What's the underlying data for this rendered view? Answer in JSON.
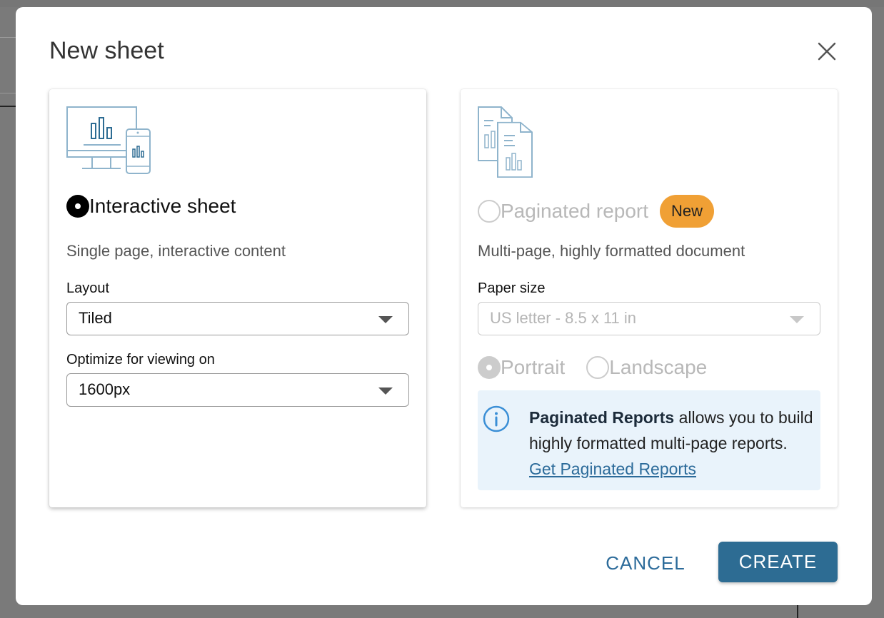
{
  "dialog": {
    "title": "New sheet"
  },
  "interactive": {
    "option_label": "Interactive sheet",
    "selected": true,
    "description": "Single page, interactive content",
    "layout_label": "Layout",
    "layout_value": "Tiled",
    "optimize_label": "Optimize for viewing on",
    "optimize_value": "1600px",
    "illustration_icon": "desktop-mobile-chart-icon"
  },
  "paginated": {
    "option_label": "Paginated report",
    "selected": false,
    "badge": "New",
    "description": "Multi-page, highly formatted document",
    "paper_label": "Paper size",
    "paper_value": "US letter - 8.5 x 11 in",
    "portrait_label": "Portrait",
    "landscape_label": "Landscape",
    "illustration_icon": "paginated-documents-icon",
    "info": {
      "bold": "Paginated Reports",
      "text": " allows you to build highly formatted multi-page reports. ",
      "link": "Get Paginated Reports"
    }
  },
  "footer": {
    "cancel_label": "CANCEL",
    "create_label": "CREATE"
  },
  "colors": {
    "primary": "#2d6c93",
    "link": "#2c6b9a",
    "badge": "#f0a035",
    "info_bg": "#e9f3fb"
  }
}
